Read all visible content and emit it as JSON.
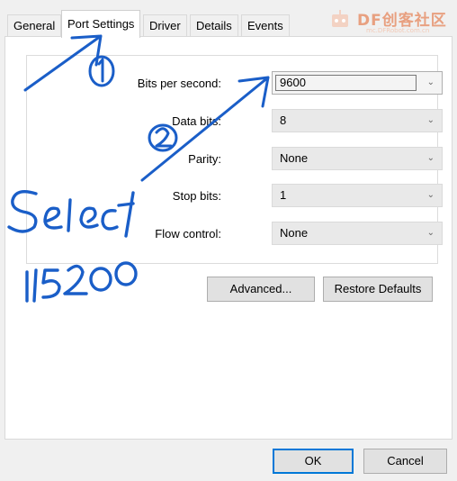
{
  "tabs": [
    {
      "label": "General"
    },
    {
      "label": "Port Settings",
      "active": true
    },
    {
      "label": "Driver"
    },
    {
      "label": "Details"
    },
    {
      "label": "Events"
    }
  ],
  "settings": {
    "bits_per_second": {
      "label": "Bits per second:",
      "value": "9600"
    },
    "data_bits": {
      "label": "Data bits:",
      "value": "8"
    },
    "parity": {
      "label": "Parity:",
      "value": "None"
    },
    "stop_bits": {
      "label": "Stop bits:",
      "value": "1"
    },
    "flow_control": {
      "label": "Flow control:",
      "value": "None"
    }
  },
  "buttons": {
    "advanced": "Advanced...",
    "restore_defaults": "Restore Defaults",
    "ok": "OK",
    "cancel": "Cancel"
  },
  "annotations": {
    "step1": "①",
    "step2": "②",
    "note_line1": "Select",
    "note_line2": "115200",
    "color": "#1a5ec8"
  },
  "watermark": {
    "text": "DF创客社区",
    "url": "mc.DFRobot.com.cn",
    "color": "#e8a080"
  }
}
